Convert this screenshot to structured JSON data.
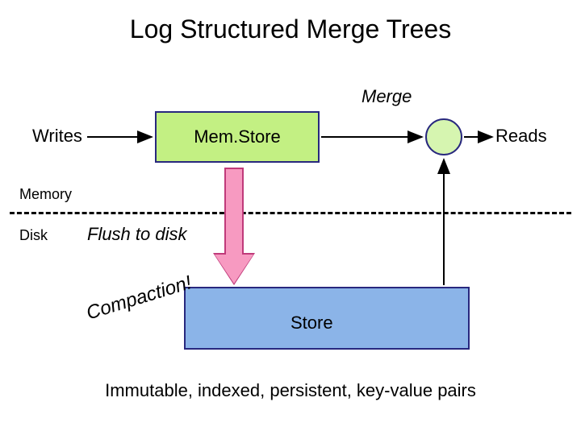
{
  "title": "Log Structured Merge Trees",
  "labels": {
    "writes": "Writes",
    "reads": "Reads",
    "merge": "Merge",
    "memory": "Memory",
    "disk": "Disk",
    "memstore": "Mem.Store",
    "flush": "Flush to disk",
    "store": "Store",
    "compaction": "Compaction!",
    "footer": "Immutable, indexed, persistent, key-value pairs"
  },
  "colors": {
    "memstore_fill": "#c3f083",
    "circle_fill": "#d6f5b0",
    "store_fill": "#8bb4e8",
    "arrow_fill": "#f79ac1",
    "border": "#28287e"
  }
}
